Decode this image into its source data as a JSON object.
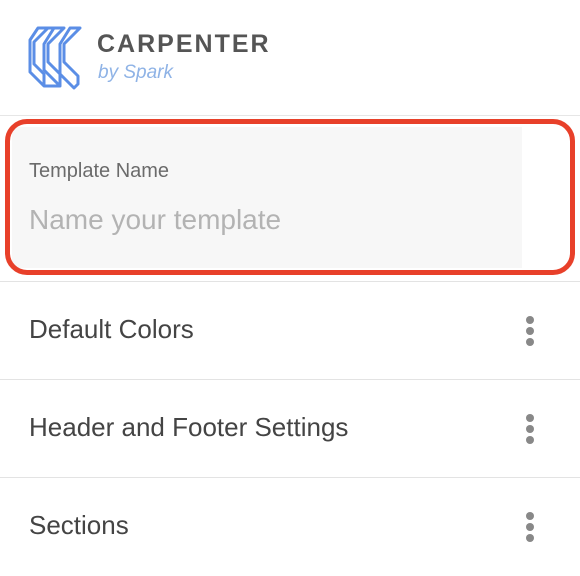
{
  "brand": {
    "name": "CARPENTER",
    "subtitle": "by Spark",
    "logo_icon": "carpenter-logo-icon",
    "logo_color": "#5b8ee6"
  },
  "template_name": {
    "label": "Template Name",
    "placeholder": "Name your template",
    "value": "",
    "highlight_color": "#e8402a"
  },
  "sections": [
    {
      "label": "Default Colors",
      "icon": "kebab-menu-icon"
    },
    {
      "label": "Header and Footer Settings",
      "icon": "kebab-menu-icon"
    },
    {
      "label": "Sections",
      "icon": "kebab-menu-icon"
    }
  ]
}
